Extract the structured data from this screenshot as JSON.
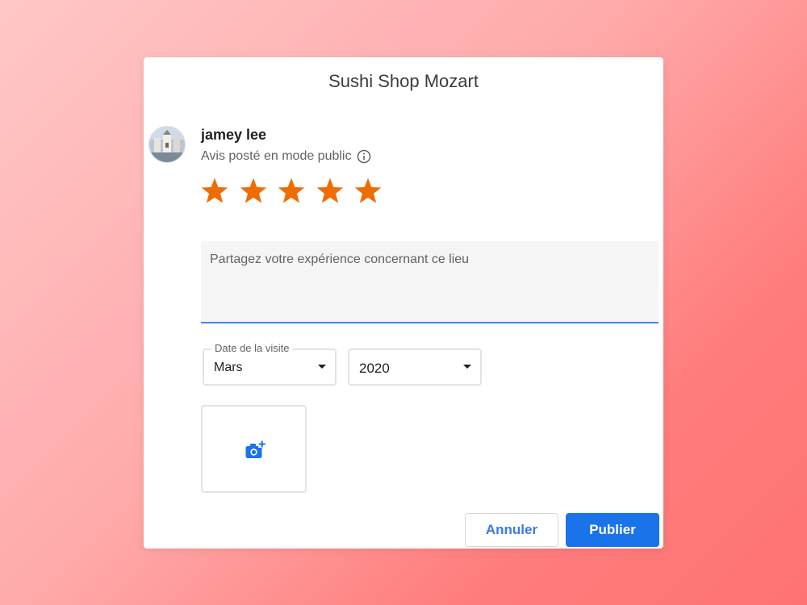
{
  "dialog": {
    "title": "Sushi Shop Mozart"
  },
  "user": {
    "name": "jamey lee",
    "visibility_note": "Avis posté en mode public"
  },
  "rating": {
    "value": 5,
    "max": 5,
    "star_color": "#ef6c00"
  },
  "review": {
    "placeholder": "Partagez votre expérience concernant ce lieu",
    "value": ""
  },
  "visit_date": {
    "label": "Date de la visite",
    "month": "Mars",
    "year": "2020"
  },
  "photo": {
    "icon": "add-photo-camera-icon"
  },
  "actions": {
    "cancel_label": "Annuler",
    "publish_label": "Publier"
  },
  "colors": {
    "accent": "#1a73e8",
    "focus_underline": "#4285f4"
  }
}
